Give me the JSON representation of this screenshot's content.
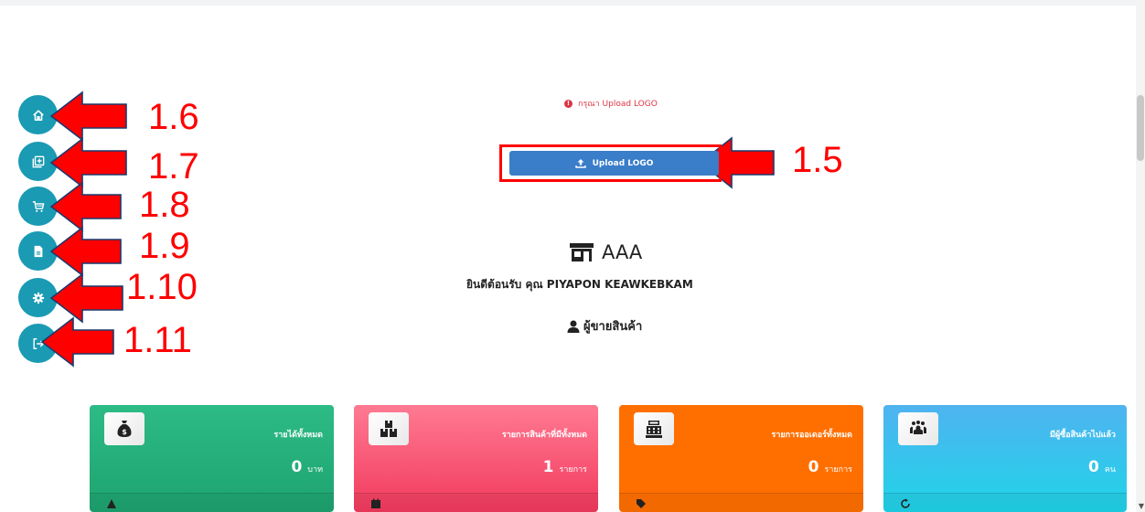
{
  "sidebar": {
    "items": [
      {
        "icon": "home-icon",
        "label": "home"
      },
      {
        "icon": "add-product-icon",
        "label": "add product"
      },
      {
        "icon": "cart-icon",
        "label": "orders"
      },
      {
        "icon": "document-icon",
        "label": "reports"
      },
      {
        "icon": "gear-icon",
        "label": "settings"
      },
      {
        "icon": "logout-icon",
        "label": "logout"
      }
    ]
  },
  "annotations": {
    "labels": [
      "1.6",
      "1.7",
      "1.8",
      "1.9",
      "1.10",
      "1.11",
      "1.5"
    ],
    "color": "#ff0000"
  },
  "notice": {
    "text": "กรุณา Upload LOGO"
  },
  "upload": {
    "label": "Upload LOGO"
  },
  "shop": {
    "name": "AAA",
    "welcome": "ยินดีต้อนรับ คุณ PIYAPON KEAWKEBKAM",
    "role": "ผู้ขายสินค้า"
  },
  "cards": [
    {
      "title": "รายได้ทั้งหมด",
      "value": "0",
      "unit": "บาท",
      "icon": "money-bag-icon",
      "color": "#1ea36f"
    },
    {
      "title": "รายการสินค้าที่มีทั้งหมด",
      "value": "1",
      "unit": "รายการ",
      "icon": "boxes-icon",
      "color": "#f23a5d"
    },
    {
      "title": "รายการออเดอร์ทั้งหมด",
      "value": "0",
      "unit": "รายการ",
      "icon": "cash-register-icon",
      "color": "#ff6f00"
    },
    {
      "title": "มีผู้ซื้อสินค้าไปแล้ว",
      "value": "0",
      "unit": "คน",
      "icon": "people-icon",
      "color": "#1fd4e8"
    }
  ],
  "colors": {
    "sidebar": "#1a9ab3",
    "upload_button": "#3a7dc9",
    "error": "#dc3545"
  }
}
